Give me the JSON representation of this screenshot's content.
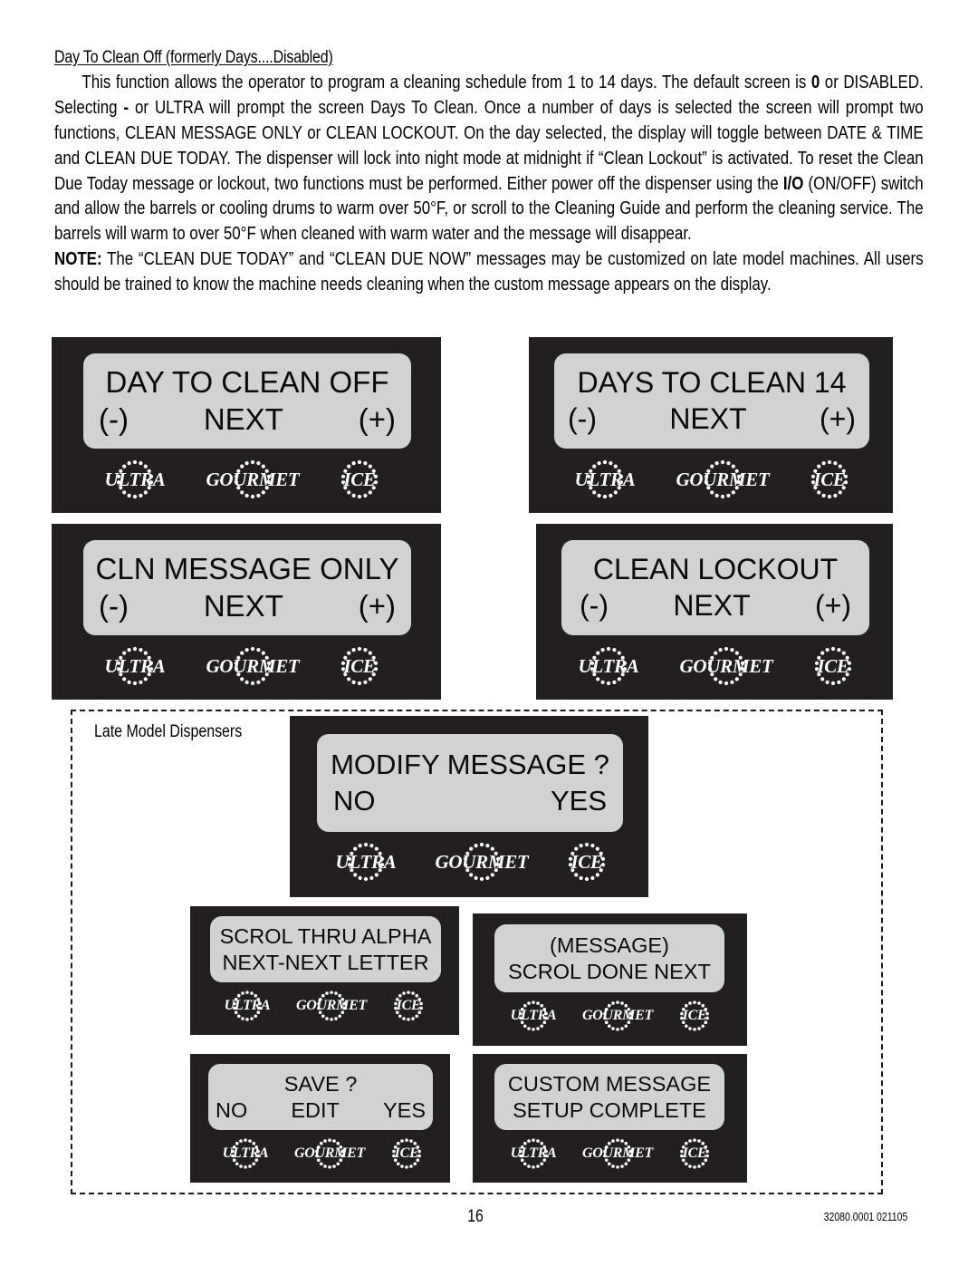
{
  "document": {
    "heading": "Day To Clean Off (formerly Days....Disabled)",
    "paragraph1_part1": "This function allows the operator to program a cleaning schedule from 1 to 14 days. The default screen is ",
    "paragraph1_bold1": "0",
    "paragraph1_part2": " or DISABLED. Selecting ",
    "paragraph1_bold2": "-",
    "paragraph1_part3": " or ULTRA will prompt the screen Days To Clean. Once a number of days is selected the screen will prompt two functions, CLEAN MESSAGE ONLY or CLEAN LOCKOUT. On the day selected, the display will toggle between DATE & TIME and CLEAN DUE TODAY. The dispenser will lock into night mode at midnight if “Clean Lockout” is activated. To reset the Clean Due Today message or lockout, two functions must be performed. Either power off the dispenser using the ",
    "paragraph1_bold3": "I/O",
    "paragraph1_part4": " (ON/OFF) switch and allow the barrels or cooling drums to warm over 50°F, or scroll to the Cleaning Guide and perform the cleaning service. The barrels will warm to over 50°F when cleaned with warm water and the message will disappear.",
    "note_label": "NOTE:",
    "note_text": " The “CLEAN DUE TODAY” and “CLEAN DUE NOW” messages may be customized on late model machines. All users should be trained to know the machine needs cleaning when the custom message appears on the display.",
    "late_model_label": "Late Model Dispensers",
    "page_number": "16",
    "doc_code": "32080.0001 021105"
  },
  "brand_buttons": {
    "left": "ULTRA",
    "middle": "GOURMET",
    "right": "ICE"
  },
  "colors": {
    "panel_body": "#231f20",
    "lcd_screen": "#d0d2d3",
    "lcd_text": "#0a0a0a",
    "brand_text": "#ffffff",
    "page_background": "#ffffff"
  },
  "panels": [
    {
      "id": "day-to-clean-off",
      "line1_left": "DAY TO CLEAN OFF",
      "line1_right": "",
      "line2_left": "(-)",
      "line2_mid": "NEXT",
      "line2_right": "(+)"
    },
    {
      "id": "days-to-clean-14",
      "line1_left": "DAYS TO CLEAN 14",
      "line1_right": "",
      "line2_left": "(-)",
      "line2_mid": "NEXT",
      "line2_right": "(+)"
    },
    {
      "id": "cln-message-only",
      "line1_left": "CLN MESSAGE ONLY",
      "line1_right": "",
      "line2_left": "(-)",
      "line2_mid": "NEXT",
      "line2_right": "(+)"
    },
    {
      "id": "clean-lockout",
      "line1_left": "CLEAN LOCKOUT",
      "line1_right": "",
      "line2_left": "(-)",
      "line2_mid": "NEXT",
      "line2_right": "(+)"
    },
    {
      "id": "modify-message",
      "line1": "MODIFY MESSAGE ?",
      "line2_left": "NO",
      "line2_right": "YES"
    },
    {
      "id": "scrol-thru-alpha",
      "line1": "SCROL THRU ALPHA",
      "line2": "NEXT-NEXT LETTER"
    },
    {
      "id": "message-scrol-done",
      "line1": "(MESSAGE)",
      "line2": "SCROL DONE NEXT"
    },
    {
      "id": "save",
      "line1": "SAVE  ?",
      "line2_left": "NO",
      "line2_mid": "EDIT",
      "line2_right": "YES"
    },
    {
      "id": "custom-message-setup-complete",
      "line1": "CUSTOM MESSAGE",
      "line2": "SETUP COMPLETE"
    }
  ]
}
